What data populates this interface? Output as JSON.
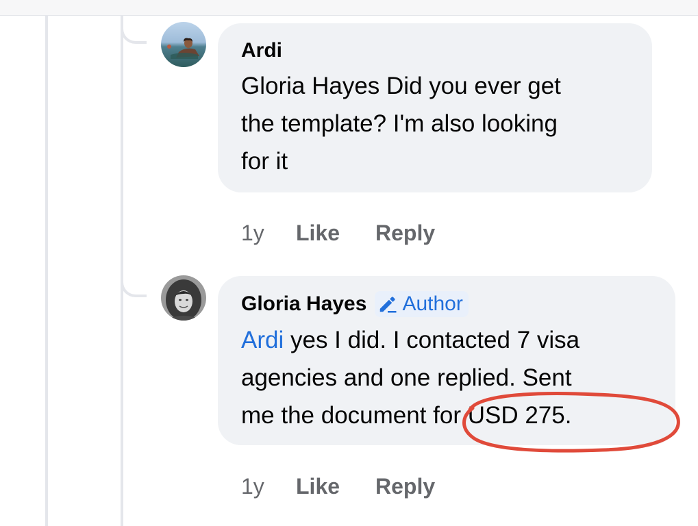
{
  "comments": [
    {
      "author": "Ardi",
      "text_lines": [
        "Gloria Hayes Did you ever get",
        "the template? I'm also looking",
        "for it"
      ],
      "time": "1y",
      "like_label": "Like",
      "reply_label": "Reply"
    },
    {
      "author": "Gloria Hayes",
      "badge_label": "Author",
      "mention": "Ardi",
      "text_first_line_rest": " yes I did. I contacted 7 visa",
      "text_lines": [
        "agencies and one replied. Sent",
        "me the document for USD 275."
      ],
      "time": "1y",
      "like_label": "Like",
      "reply_label": "Reply"
    }
  ],
  "colors": {
    "bubble": "#f0f2f5",
    "meta_text": "#65676b",
    "link_blue": "#216fdb",
    "annotation_red": "#e04a3a",
    "thread_line": "#e4e6eb"
  },
  "icons": {
    "author_badge": "pencil-icon"
  }
}
